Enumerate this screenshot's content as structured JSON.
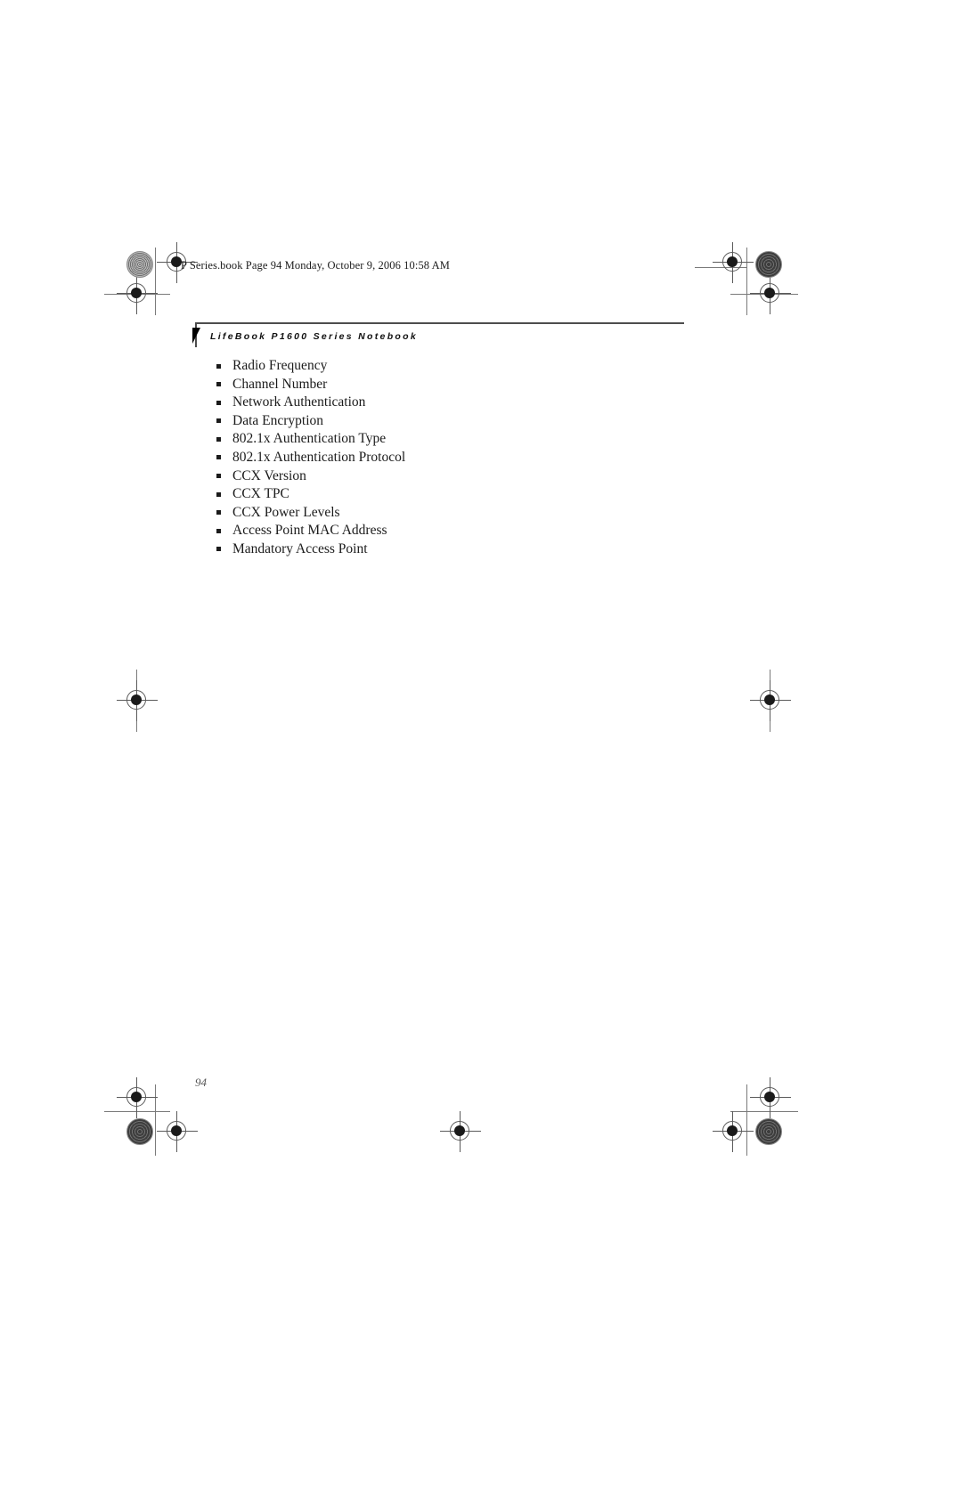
{
  "document": {
    "file_header": "P Series.book  Page 94  Monday, October 9, 2006  10:58 AM",
    "running_head": "LifeBook P1600 Series Notebook",
    "page_number": "94",
    "bullet_items": [
      "Radio Frequency",
      "Channel Number",
      "Network Authentication",
      "Data Encryption",
      "802.1x Authentication Type",
      "802.1x Authentication Protocol",
      "CCX Version",
      "CCX TPC",
      "CCX Power Levels",
      "Access Point MAC Address",
      "Mandatory Access Point"
    ]
  },
  "colors": {
    "text": "#1b1b1b",
    "rule": "#4d4d4d",
    "folio": "#555555",
    "mark": "#5a5a5a",
    "page_background": "#ffffff"
  }
}
